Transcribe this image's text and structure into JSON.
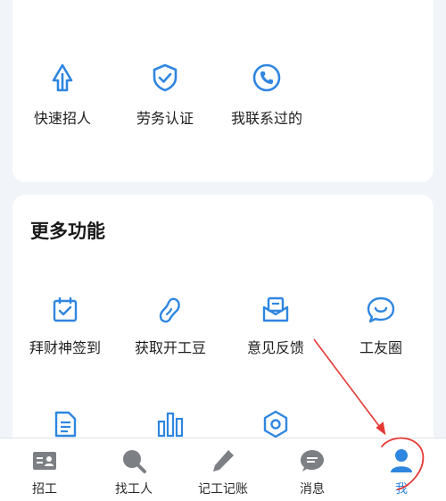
{
  "top_actions": [
    {
      "label": "快速招人",
      "icon": "recruit-arrow-icon"
    },
    {
      "label": "劳务认证",
      "icon": "shield-check-icon"
    },
    {
      "label": "我联系过的",
      "icon": "phone-icon"
    }
  ],
  "more": {
    "title": "更多功能",
    "items": [
      {
        "label": "拜财神签到",
        "icon": "calendar-check-icon"
      },
      {
        "label": "获取开工豆",
        "icon": "bean-icon"
      },
      {
        "label": "意见反馈",
        "icon": "feedback-mail-icon"
      },
      {
        "label": "工友圈",
        "icon": "chat-bubble-icon"
      },
      {
        "label": "",
        "icon": "document-icon"
      },
      {
        "label": "",
        "icon": "bar-chart-icon"
      },
      {
        "label": "",
        "icon": "settings-hexagon-icon"
      }
    ]
  },
  "tabbar": [
    {
      "label": "招工",
      "icon": "id-card-icon"
    },
    {
      "label": "找工人",
      "icon": "search-icon"
    },
    {
      "label": "记工记账",
      "icon": "pencil-icon"
    },
    {
      "label": "消息",
      "icon": "message-icon"
    },
    {
      "label": "我",
      "icon": "user-icon",
      "active": true
    }
  ],
  "colors": {
    "accent": "#2f86e0",
    "tab_icon": "#7c7f84",
    "annotation": "#e53935"
  }
}
